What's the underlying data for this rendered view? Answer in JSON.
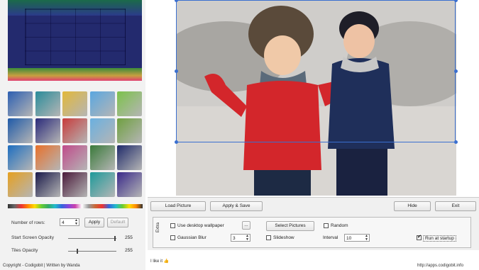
{
  "preview": {
    "alt": "game preview"
  },
  "tiles": [
    "#2c5fb2",
    "#2a8c9a",
    "#e2b83a",
    "#5aa7e0",
    "#7cc24a",
    "#1f5aa8",
    "#2b2b7a",
    "#c83b3b",
    "#6ab0e0",
    "#6fa040",
    "#1d6ec0",
    "#e8702a",
    "#c04a8a",
    "#3a7a3a",
    "#1f2a6a",
    "#e6a020",
    "#1a1a4a",
    "#4a1a3a",
    "#1e9a9a",
    "#3a2a8a"
  ],
  "settings": {
    "rows_label": "Number of rows:",
    "rows_value": "4",
    "apply_label": "Apply",
    "default_label": "Default",
    "start_opacity_label": "Start Screen Opacity",
    "start_opacity_value": "255",
    "tiles_opacity_label": "Tiles Opacity",
    "tiles_opacity_value": "255"
  },
  "toolbar": {
    "load_label": "Load Picture",
    "apply_save_label": "Apply & Save",
    "hide_label": "Hide",
    "exit_label": "Exit"
  },
  "extra": {
    "tab_label": "Extra",
    "use_wallpaper_label": "Use desktop wallpaper",
    "browse_label": "...",
    "gaussian_label": "Gaussian Blur",
    "gaussian_value": "3",
    "select_pictures_label": "Select Pictures",
    "random_label": "Random",
    "slideshow_label": "Slideshow",
    "interval_label": "Interval",
    "interval_value": "10",
    "run_startup_label": "Run at startup",
    "run_startup_checked": true
  },
  "footer": {
    "copyright": "Copyright - Codigobit | Written by Wanda",
    "like": "I like it",
    "url": "http://apps.codigobit.info"
  }
}
